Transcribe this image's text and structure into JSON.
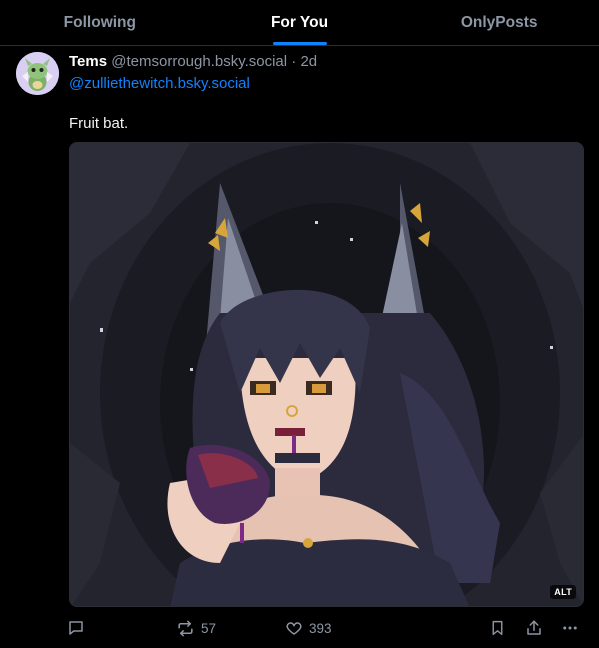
{
  "tabs": [
    {
      "label": "Following",
      "active": false
    },
    {
      "label": "For You",
      "active": true
    },
    {
      "label": "OnlyPosts",
      "active": false
    }
  ],
  "post": {
    "author_name": "Tems",
    "author_handle": "@temsorrough.bsky.social",
    "separator": "·",
    "age": "2d",
    "mention": "@zulliethewitch.bsky.social",
    "text": "Fruit bat.",
    "image_alt_badge": "ALT",
    "reposts": "57",
    "likes": "393"
  },
  "icons": {
    "reply": "reply-bubble-icon",
    "repost": "repost-icon",
    "like": "heart-icon",
    "bookmark": "bookmark-icon",
    "share": "share-icon",
    "more": "more-dots-icon"
  },
  "colors": {
    "background": "#000000",
    "accent": "#1083fe",
    "muted": "#8d96a4",
    "border": "#2b2e33"
  }
}
